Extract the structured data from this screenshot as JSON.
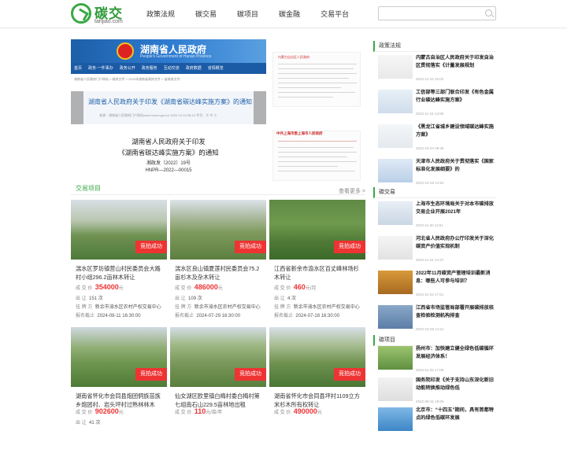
{
  "header": {
    "logo_text": "碳交",
    "logo_sub": "tanjiao.com",
    "nav": [
      "政策法规",
      "碳交易",
      "碳项目",
      "碳金融",
      "交易平台"
    ]
  },
  "banner": {
    "site_title": "湖南省人民政府",
    "site_title_en": "People's Government of Hunan Province",
    "menu": [
      "首页",
      "政务·一件事办",
      "政务公开",
      "政务服务",
      "互动交流",
      "政府数据",
      "省情概览"
    ],
    "crumb": "湖南省人民政府门户网站 > 政府文件 > 2022年湖南省政府文件 > 省政府文件",
    "slide_title": "湖南省人民政府关于印发《湖南省碳达峰实施方案》的通知",
    "slide_meta": "来源：湖南省人民政府门户网站www.hunan.gov.cn      2022-10-18 08:16      字号：大 中 小",
    "doc_line1": "湖南省人民政府关于印发",
    "doc_line2": "《湖南省碳达峰实施方案》的通知",
    "doc_no": "湘政发〔2022〕19号",
    "doc_code": "HNPR—2022—00015"
  },
  "scan": {
    "top_title": "内蒙古自治区人民政府",
    "bot_title": "中共上海市委上海市人民政府"
  },
  "section": {
    "title": "交易项目",
    "more": "查看更多 >"
  },
  "labels": {
    "deal": "成 交 价",
    "lessor": "出    让",
    "listing": "挂 牌 方",
    "deadline": "报名截止"
  },
  "badge": "竞拍成功",
  "cards": [
    {
      "title": "湍水区罗坊镇营山村民委员会大路村小组296.2亩林木转让",
      "price": "354000",
      "unit": "元",
      "area": "151 次",
      "lister": "新余市渝水区农村产权交易中心",
      "deadline": "2024-09-11 16:30:00"
    },
    {
      "title": "湍水区良山镇夏莲村民委员会75.2亩杉木及杂木转让",
      "price": "486000",
      "unit": "元",
      "area": "109 次",
      "lister": "新余市渝水区农村产权交易中心",
      "deadline": "2024-07-29 16:30:00"
    },
    {
      "title": "江西省新余市渝水区百丈峰林场杉木转让",
      "price": "460",
      "unit": "元/月",
      "area": "4 次",
      "lister": "新余市渝水区农村产权交易中心",
      "deadline": "2024-07-18 16:30:00"
    },
    {
      "title": "湖南省怀化市会同县炮团侗族苗族乡炮团村、岩头坪村过熟林林木",
      "price": "902600",
      "unit": "元",
      "area": "41 次",
      "lister": "",
      "deadline": ""
    },
    {
      "title": "仙女湖区欧里镇白梅村委白梅村第七组南石山229.5亩林地出租",
      "price": "110",
      "unit": "元/亩/年",
      "area": "",
      "lister": "",
      "deadline": ""
    },
    {
      "title": "湖南省怀化市会同县坪村1109立方米杉木所有权转让",
      "price": "490000",
      "unit": "元",
      "area": "",
      "lister": "",
      "deadline": ""
    }
  ],
  "sidebar": [
    {
      "title": "政策法规",
      "items": [
        {
          "title": "内蒙古自治区人民政府关于印发自治区贯彻落实《计量发展规划",
          "date": "2022-11-16 15:02"
        },
        {
          "title": "工信部等三部门联合印发《有色金属行业碳达峰实施方案》",
          "date": "2022-11-16 14:55"
        },
        {
          "title": "《黑龙江省城乡建设领域碳达峰实施方案》",
          "date": "2022-10-24 08:36"
        },
        {
          "title": "天津市人民政府关于贯彻落实《国家标准化发展纲要》的",
          "date": "2022-10-18 14:52"
        }
      ]
    },
    {
      "title": "碳交易",
      "items": [
        {
          "title": "上海市生态环境局关于对本市碳排放交易企业开展2021年",
          "date": "2022-11-30 11:51"
        },
        {
          "title": "河北省人民政府办公厅印发关于深化碳资产价值实现机制",
          "date": "2022-11-24 14:37"
        },
        {
          "title": "2022年11月碳资产管理培训最新消息：哪些人可参与培训？",
          "date": "2022-11-03 17:51"
        },
        {
          "title": "江西省市场监管局部署开展碳排放核查检验检测机构排查",
          "date": "2022-10-28 14:21"
        }
      ]
    },
    {
      "title": "碳项目",
      "items": [
        {
          "title": "扬州市：加快建立健全绿色低碳循环发展经济体系！",
          "date": "2022-11-25 17:08"
        },
        {
          "title": "国务院印发《关于支持山东深化新旧动能转换推动绿色低",
          "date": "2022-08-31 18:06"
        },
        {
          "title": "北京市：“十四五”期间，具有首都特点的绿色低碳环发展",
          "date": ""
        }
      ]
    }
  ]
}
